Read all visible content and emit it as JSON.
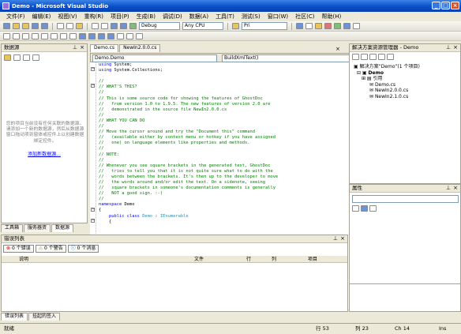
{
  "window": {
    "title": "Demo - Microsoft Visual Studio"
  },
  "menu": [
    "文件(F)",
    "编辑(E)",
    "视图(V)",
    "重构(R)",
    "项目(P)",
    "生成(B)",
    "调试(D)",
    "数据(A)",
    "工具(T)",
    "测试(S)",
    "窗口(W)",
    "社区(C)",
    "帮助(H)"
  ],
  "toolbar": {
    "config": "Debug",
    "platform": "Any CPU",
    "find": "Pri"
  },
  "data_sources": {
    "title": "数据源",
    "hint": "您的项目当前没有任何关联的数据源。请添加一个新的数据源，然后从数据源窗口拖动项到窗体或控件上以创建数据绑定控件。",
    "link": "添加新数据源..."
  },
  "left_tabs": [
    "工具箱",
    "服务器资",
    "数据源"
  ],
  "editor": {
    "tabs": [
      "Demo.cs",
      "NewIn2.0.0.cs"
    ],
    "class_combo": "Demo.Demo",
    "member_combo": "BuildXmlText()",
    "lines": [
      [
        [
          "kw",
          "using"
        ],
        [
          "pl",
          " System;"
        ]
      ],
      [
        [
          "kw",
          "using"
        ],
        [
          "pl",
          " System.Collections;"
        ]
      ],
      [
        [
          "pl",
          ""
        ]
      ],
      [
        [
          "co",
          "//"
        ]
      ],
      [
        [
          "co",
          "// WHAT'S THIS?"
        ]
      ],
      [
        [
          "co",
          "//"
        ]
      ],
      [
        [
          "co",
          "// This is some source code for showing the features of GhostDoc"
        ]
      ],
      [
        [
          "co",
          "//   from version 1.0 to 1.9.5. The new features of version 2.0 are"
        ]
      ],
      [
        [
          "co",
          "//   demonstrated in the source file NewIn2.0.0.cs"
        ]
      ],
      [
        [
          "co",
          "//"
        ]
      ],
      [
        [
          "co",
          "// WHAT YOU CAN DO"
        ]
      ],
      [
        [
          "co",
          "//"
        ]
      ],
      [
        [
          "co",
          "// Move the cursor around and try the \"Document this\" command"
        ]
      ],
      [
        [
          "co",
          "//   (available either by context menu or hotkey if you have assigned"
        ]
      ],
      [
        [
          "co",
          "//   one) on language elements like properties and methods."
        ]
      ],
      [
        [
          "co",
          "//"
        ]
      ],
      [
        [
          "co",
          "// NOTE:"
        ]
      ],
      [
        [
          "co",
          "//"
        ]
      ],
      [
        [
          "co",
          "// Whenever you see square brackets in the generated text, GhostDoc"
        ]
      ],
      [
        [
          "co",
          "//   tries to tell you that it is not quite sure what to do with the"
        ]
      ],
      [
        [
          "co",
          "//   words between the brackets. It's then up to the developer to move"
        ]
      ],
      [
        [
          "co",
          "//   the words around and/or edit the text. On a sidenote, seeing"
        ]
      ],
      [
        [
          "co",
          "//   square brackets in someone's documentation comments is generally"
        ]
      ],
      [
        [
          "co",
          "//   NOT a good sign. :-)"
        ]
      ],
      [
        [
          "co",
          "//"
        ]
      ],
      [
        [
          "kw",
          "namespace"
        ],
        [
          "pl",
          " Demo"
        ]
      ],
      [
        [
          "pl",
          "{"
        ]
      ],
      [
        [
          "pl",
          "    "
        ],
        [
          "kw",
          "public class"
        ],
        [
          "pl",
          " "
        ],
        [
          "ty",
          "Demo"
        ],
        [
          "pl",
          " : "
        ],
        [
          "ty",
          "IEnumerable"
        ]
      ],
      [
        [
          "pl",
          "    {"
        ]
      ]
    ]
  },
  "solution_explorer": {
    "title": "解决方案资源管理器 - Demo",
    "items": [
      "解决方案“Demo”(1 个项目)",
      "Demo",
      "引用",
      "Demo.cs",
      "NewIn2.0.0.cs",
      "NewIn2.1.0.cs"
    ]
  },
  "properties": {
    "title": "属性"
  },
  "error_list": {
    "title": "错误列表",
    "errors": "0 个错误",
    "warnings": "0 个警告",
    "messages": "0 个消息",
    "columns": [
      "说明",
      "文件",
      "行",
      "列",
      "项目"
    ]
  },
  "bottom_tabs": [
    "错误列表",
    "挂起的签入"
  ],
  "status": {
    "left": "就绪",
    "line": "行 53",
    "col": "列 23",
    "ch": "Ch 14",
    "mode": "Ins"
  }
}
